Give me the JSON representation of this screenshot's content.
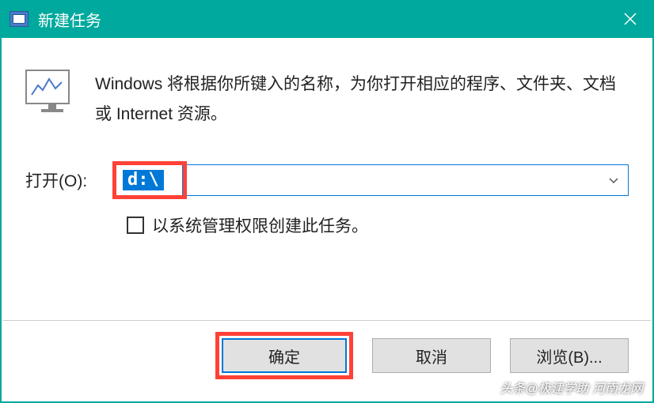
{
  "titlebar": {
    "title": "新建任务"
  },
  "description": "Windows 将根据你所键入的名称，为你打开相应的程序、文件夹、文档或 Internet 资源。",
  "open": {
    "label": "打开(O)",
    "value": "d:\\"
  },
  "checkbox": {
    "label": "以系统管理权限创建此任务。",
    "checked": false
  },
  "buttons": {
    "ok": "确定",
    "cancel": "取消",
    "browse": "浏览(B)..."
  },
  "watermark": "头条@极建学助 河南龙网",
  "colors": {
    "accent": "#00a99d",
    "highlight": "#ff4136",
    "selection": "#0078d7"
  }
}
